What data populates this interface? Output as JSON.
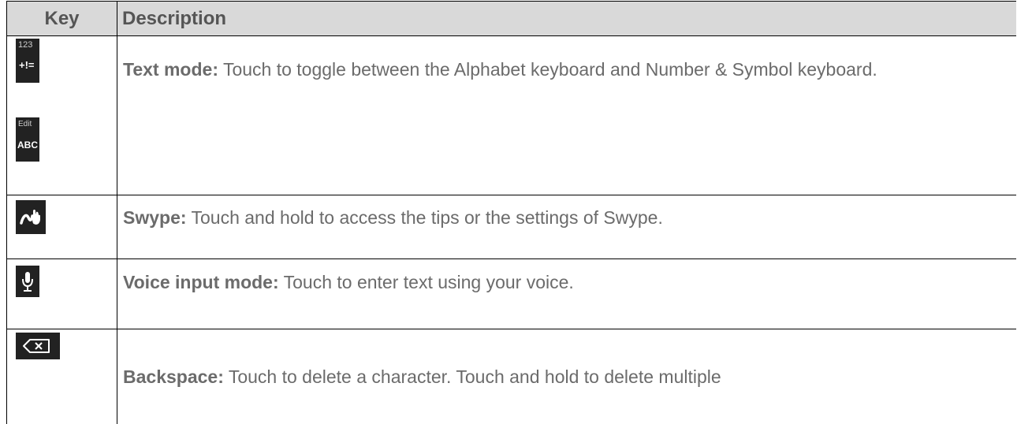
{
  "table": {
    "headers": {
      "key": "Key",
      "description": "Description"
    },
    "rows": [
      {
        "keys": [
          {
            "icon": "number-symbol-key-icon",
            "top_label": "123",
            "main_label": "+!="
          },
          {
            "icon": "alphabet-key-icon",
            "top_label": "Edit",
            "main_label": "ABC"
          }
        ],
        "term": "Text mode:",
        "text": " Touch to toggle between the Alphabet keyboard and Number & Symbol keyboard."
      },
      {
        "keys": [
          {
            "icon": "swype-key-icon"
          }
        ],
        "term": "Swype:",
        "text": " Touch and hold to access the tips or the settings of Swype."
      },
      {
        "keys": [
          {
            "icon": "microphone-key-icon"
          }
        ],
        "term": "Voice input mode:",
        "text": " Touch to enter text using your voice."
      },
      {
        "keys": [
          {
            "icon": "backspace-key-icon"
          }
        ],
        "term": "Backspace:",
        "text": " Touch to delete a character. Touch and hold to delete multiple"
      }
    ]
  }
}
